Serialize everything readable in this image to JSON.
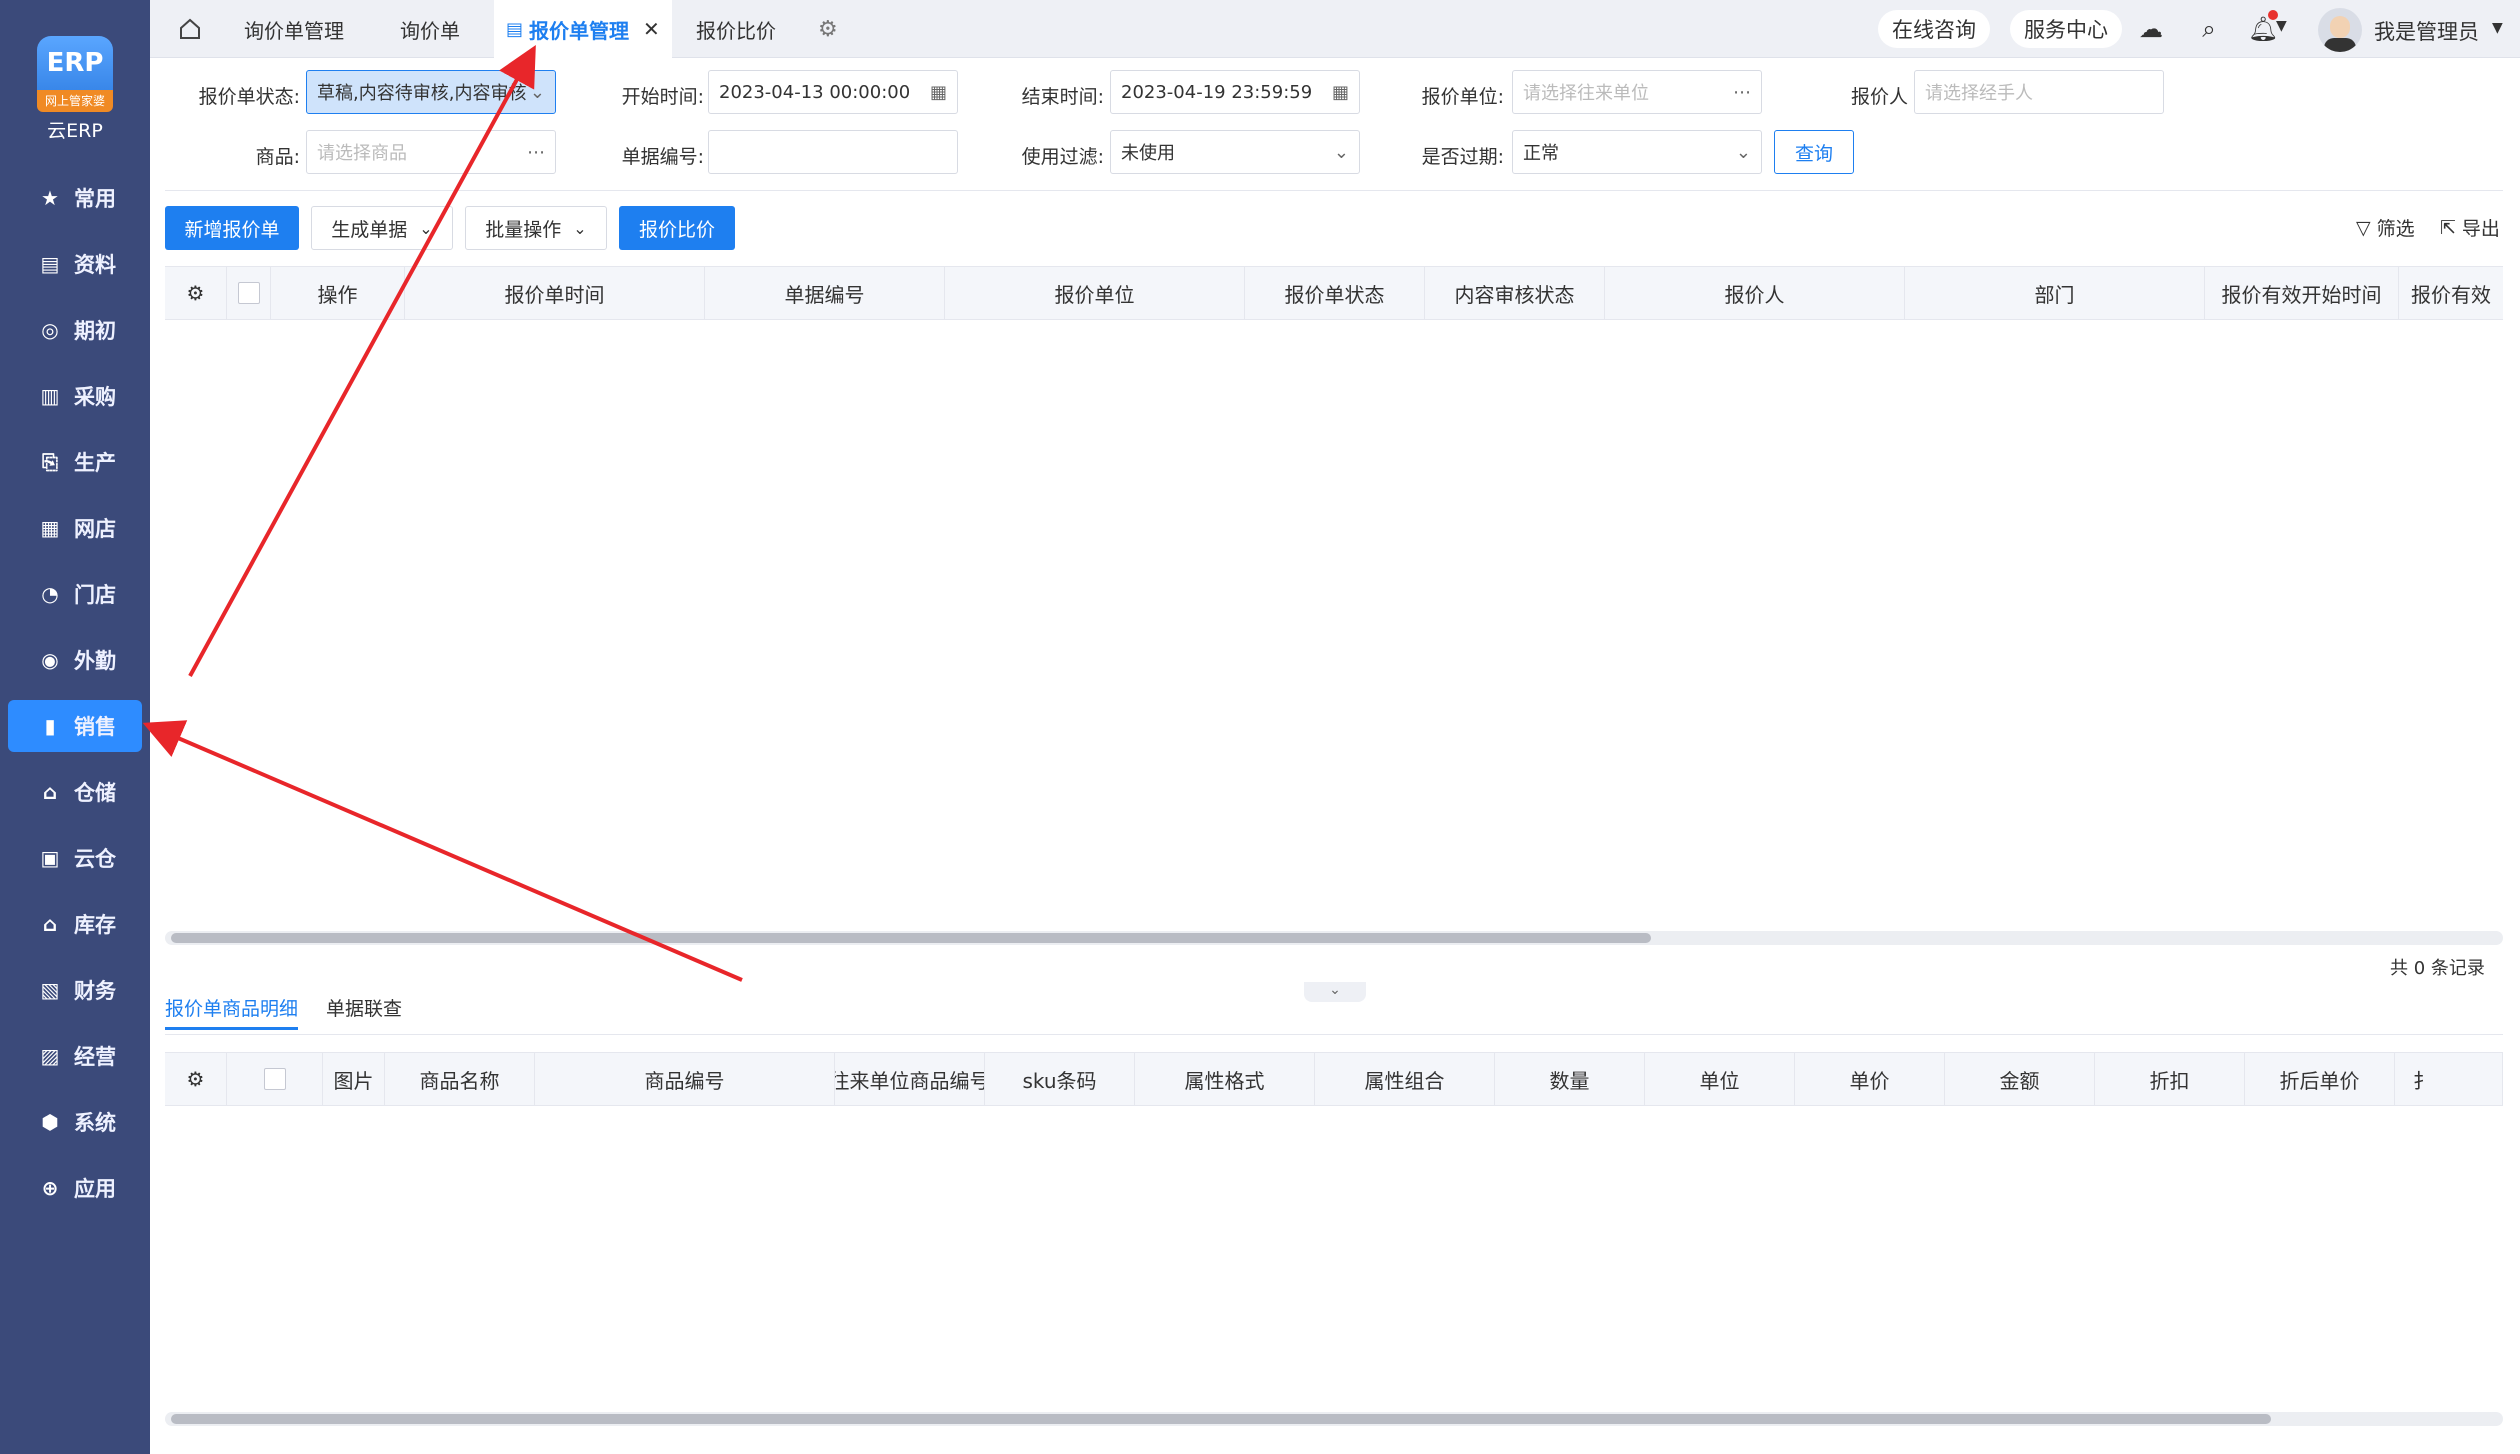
{
  "sidebar": {
    "logo_tag": "网上管家婆",
    "logo_name": "云ERP",
    "items": [
      {
        "label": "常用",
        "icon": "star-icon"
      },
      {
        "label": "资料",
        "icon": "document-icon"
      },
      {
        "label": "期初",
        "icon": "target-icon"
      },
      {
        "label": "采购",
        "icon": "cart-icon"
      },
      {
        "label": "生产",
        "icon": "production-icon"
      },
      {
        "label": "网店",
        "icon": "shop-icon"
      },
      {
        "label": "门店",
        "icon": "store-icon"
      },
      {
        "label": "外勤",
        "icon": "field-icon"
      },
      {
        "label": "销售",
        "icon": "sales-icon",
        "active": true
      },
      {
        "label": "仓储",
        "icon": "warehouse-icon"
      },
      {
        "label": "云仓",
        "icon": "cloud-warehouse-icon"
      },
      {
        "label": "库存",
        "icon": "inventory-icon"
      },
      {
        "label": "财务",
        "icon": "finance-icon"
      },
      {
        "label": "经营",
        "icon": "business-icon"
      },
      {
        "label": "系统",
        "icon": "system-icon"
      },
      {
        "label": "应用",
        "icon": "apps-icon"
      }
    ]
  },
  "tabs": [
    {
      "label": "询价单管理"
    },
    {
      "label": "询价单"
    },
    {
      "label": "报价单管理",
      "active": true
    },
    {
      "label": "报价比价"
    }
  ],
  "top_right": {
    "consult": "在线咨询",
    "service": "服务中心",
    "user": "我是管理员"
  },
  "filters": {
    "status_label": "报价单状态:",
    "status_value": "草稿,内容待审核,内容审核",
    "start_label": "开始时间:",
    "start_value": "2023-04-13 00:00:00",
    "end_label": "结束时间:",
    "end_value": "2023-04-19 23:59:59",
    "unit_label": "报价单位:",
    "unit_placeholder": "请选择往来单位",
    "person_label": "报价人",
    "person_placeholder": "请选择经手人",
    "goods_label": "商品:",
    "goods_placeholder": "请选择商品",
    "billno_label": "单据编号:",
    "billno_value": "",
    "filter_label": "使用过滤:",
    "filter_value": "未使用",
    "expired_label": "是否过期:",
    "expired_value": "正常",
    "query_btn": "查询"
  },
  "toolbar": {
    "new_btn": "新增报价单",
    "gen_btn": "生成单据",
    "batch_btn": "批量操作",
    "compare_btn": "报价比价",
    "filter_link": "筛选",
    "export_link": "导出"
  },
  "main_table": {
    "columns": [
      "操作",
      "报价单时间",
      "单据编号",
      "报价单位",
      "报价单状态",
      "内容审核状态",
      "报价人",
      "部门",
      "报价有效开始时间",
      "报价有效"
    ],
    "total": "共 0 条记录"
  },
  "detail_tabs": [
    "报价单商品明细",
    "单据联查"
  ],
  "detail_table": {
    "columns": [
      "图片",
      "商品名称",
      "商品编号",
      "往来单位商品编号",
      "sku条码",
      "属性格式",
      "属性组合",
      "数量",
      "单位",
      "单价",
      "金额",
      "折扣",
      "折后单价",
      "扌"
    ]
  }
}
